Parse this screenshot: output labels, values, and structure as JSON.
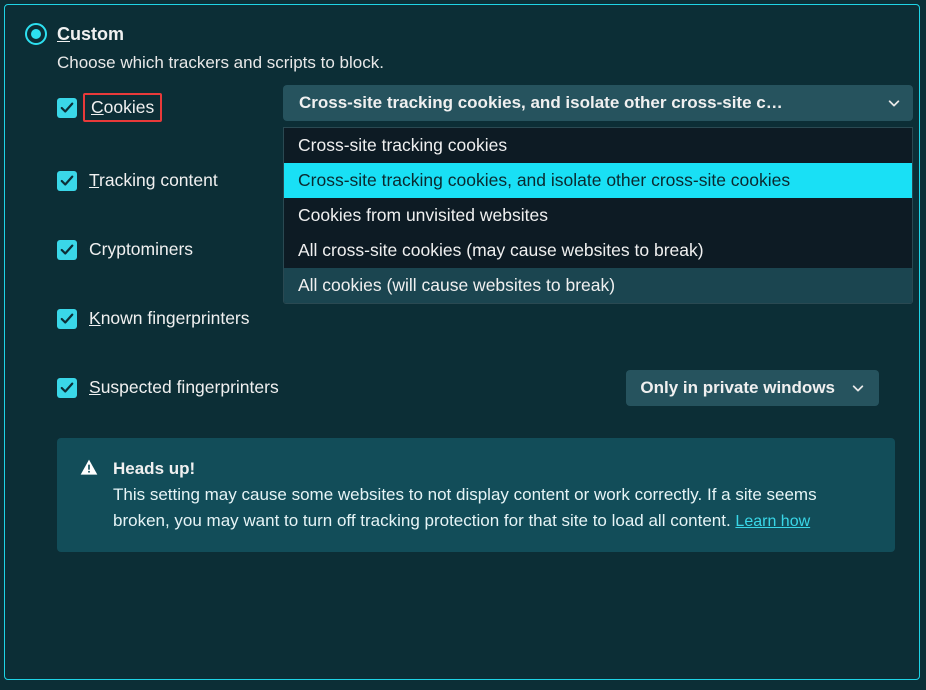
{
  "header": {
    "title_pre": "C",
    "title_rest": "ustom"
  },
  "subtitle": "Choose which trackers and scripts to block.",
  "opts": {
    "cookies": {
      "pre": "C",
      "rest": "ookies"
    },
    "tracking": {
      "pre": "T",
      "rest": "racking content"
    },
    "crypto": "Cryptominers",
    "known": {
      "pre": "K",
      "rest": "nown fingerprinters"
    },
    "susp": {
      "pre": "S",
      "rest": "uspected fingerprinters"
    }
  },
  "cookies_select": {
    "display": "Cross-site tracking cookies, and isolate other cross-site c…",
    "options": [
      "Cross-site tracking cookies",
      "Cross-site tracking cookies, and isolate other cross-site cookies",
      "Cookies from unvisited websites",
      "All cross-site cookies (may cause websites to break)",
      "All cookies (will cause websites to break)"
    ],
    "selected_index": 1,
    "hovered_index": 4
  },
  "susp_select": {
    "display": "Only in private windows"
  },
  "info": {
    "title": "Heads up!",
    "body1": "This setting may cause some websites to not display content or work correctly. If a site seems broken, you may want to turn off tracking protection for that site to load all content. ",
    "link": "Learn how"
  }
}
